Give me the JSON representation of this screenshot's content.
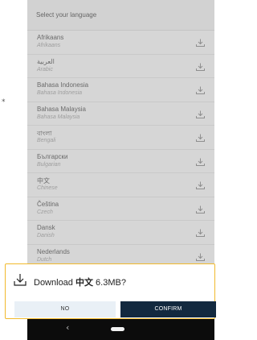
{
  "background": {
    "marker": "*"
  },
  "header": {
    "title": "Select your language"
  },
  "languages": [
    {
      "name": "Afrikaans",
      "native": "Afrikaans"
    },
    {
      "name": "العربية",
      "native": "Arabic"
    },
    {
      "name": "Bahasa Indonesia",
      "native": "Bahasa Indonesia"
    },
    {
      "name": "Bahasa Malaysia",
      "native": "Bahasa Malaysia"
    },
    {
      "name": "বাংলা",
      "native": "Bengali"
    },
    {
      "name": "Български",
      "native": "Bulgarian"
    },
    {
      "name": "中文",
      "native": "Chinese"
    },
    {
      "name": "Čeština",
      "native": "Czech"
    },
    {
      "name": "Dansk",
      "native": "Danish"
    },
    {
      "name": "Nederlands",
      "native": "Dutch"
    }
  ],
  "dialog": {
    "prefix": "Download",
    "language": "中文",
    "size": "6.3MB?",
    "no_label": "NO",
    "confirm_label": "CONFIRM",
    "border_color": "#f1b92c"
  },
  "navbar": {
    "back_glyph": "‹"
  },
  "icons": {
    "row": "download-icon",
    "dialog": "download-icon",
    "nav_back": "back-icon",
    "nav_home": "home-pill-icon"
  },
  "colors": {
    "confirm_bg": "#13293f",
    "no_bg": "#e9f0f6",
    "dim_list_bg": "#d6d6d6"
  }
}
